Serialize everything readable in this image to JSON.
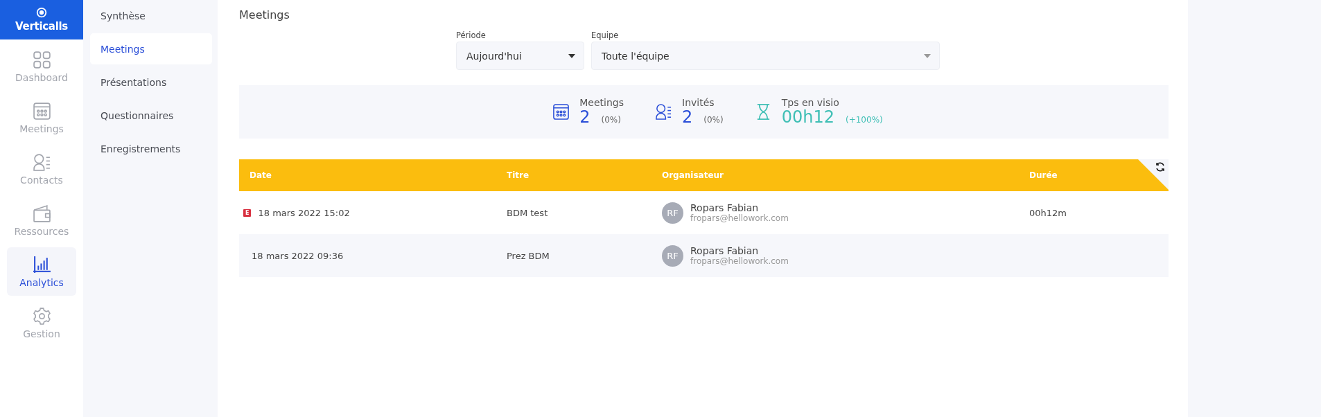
{
  "logo": {
    "text": "Verticalls"
  },
  "nav": [
    {
      "label": "Dashboard",
      "kind": "grid",
      "selected": false
    },
    {
      "label": "Meetings",
      "kind": "calendar",
      "selected": false
    },
    {
      "label": "Contacts",
      "kind": "contact",
      "selected": false
    },
    {
      "label": "Ressources",
      "kind": "wallet",
      "selected": false
    },
    {
      "label": "Analytics",
      "kind": "chart",
      "selected": true
    },
    {
      "label": "Gestion",
      "kind": "gear",
      "selected": false
    }
  ],
  "subnav": [
    {
      "label": "Synthèse",
      "selected": false
    },
    {
      "label": "Meetings",
      "selected": true
    },
    {
      "label": "Présentations",
      "selected": false
    },
    {
      "label": "Questionnaires",
      "selected": false
    },
    {
      "label": "Enregistrements",
      "selected": false
    }
  ],
  "page_title": "Meetings",
  "filters": [
    {
      "label": "Période",
      "value": "Aujourd'hui"
    },
    {
      "label": "Equipe",
      "value": "Toute l'équipe"
    }
  ],
  "stats": [
    {
      "kind": "calendar",
      "label": "Meetings",
      "value": "2",
      "change": "(0%)",
      "color": "#2b4fd8"
    },
    {
      "kind": "contact",
      "label": "Invités",
      "value": "2",
      "change": "(0%)",
      "color": "#2b4fd8"
    },
    {
      "kind": "hourglass",
      "label": "Tps en visio",
      "value": "00h12",
      "change": "(+100%)",
      "color": "#3fbfb5"
    }
  ],
  "table": {
    "columns": [
      "Date",
      "Titre",
      "Organisateur",
      "Durée"
    ],
    "rows": [
      {
        "badge": "E",
        "date": "18 mars 2022 15:02",
        "title": "BDM test",
        "initials": "RF",
        "name": "Ropars Fabian",
        "email": "fropars@hellowork.com",
        "duration": "00h12m"
      },
      {
        "date": "18 mars 2022 09:36",
        "title": "Prez BDM",
        "initials": "RF",
        "name": "Ropars Fabian",
        "email": "fropars@hellowork.com"
      }
    ]
  }
}
